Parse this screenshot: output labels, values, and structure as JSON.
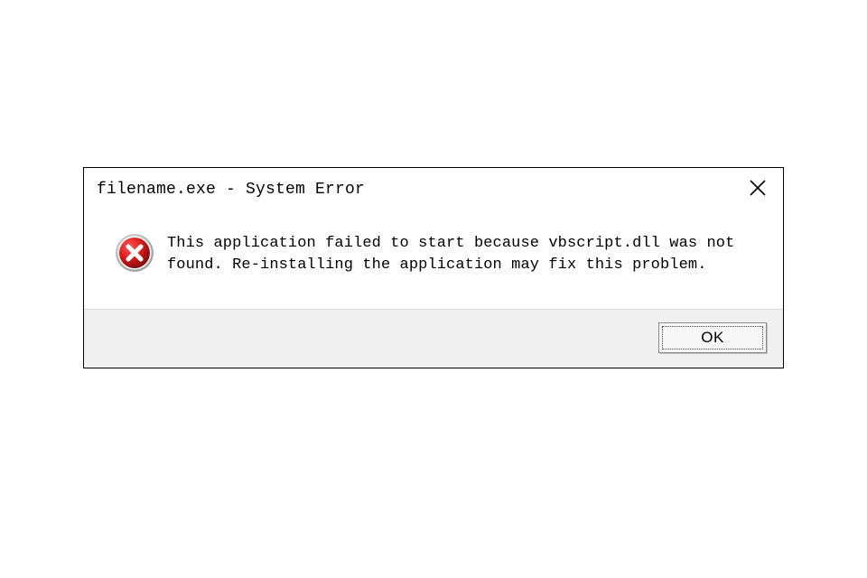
{
  "dialog": {
    "title": "filename.exe - System Error",
    "message": "This application failed to start because vbscript.dll was not found. Re-installing the application may fix this problem.",
    "ok_label": "OK"
  }
}
